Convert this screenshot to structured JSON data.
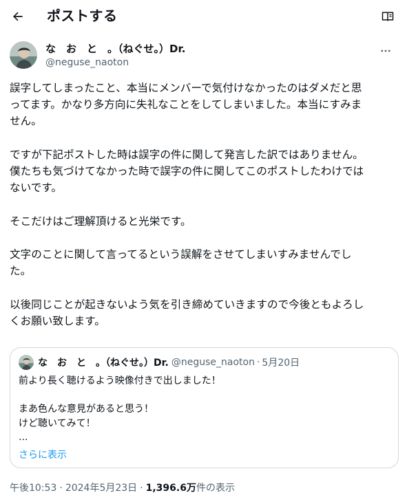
{
  "header": {
    "title": "ポストする",
    "back_icon": "arrow-left-icon",
    "reader_icon": "book-reader-icon"
  },
  "author": {
    "display_name": "な　お　と　。（ねぐせ。）Dr.",
    "handle": "@neguse_naoton",
    "more_icon": "more-horizontal-icon"
  },
  "tweet": {
    "paragraphs": [
      "誤字してしまったこと、本当にメンバーで気付けなかったのはダメだと思\nってます。かなり多方向に失礼なことをしてしまいました。本当にすみま\nせん。",
      "ですが下記ポストした時は誤字の件に関して発言した訳ではありません。\n僕たちも気づけてなかった時で誤字の件に関してこのポストしたわけでは\nないです。",
      "そこだけはご理解頂けると光栄です。",
      "文字のことに関して言ってるという誤解をさせてしまいすみませんでし\nた。",
      "以後同じことが起きないよう気を引き締めていきますので今後ともよろし\nくお願い致します。"
    ]
  },
  "quote": {
    "display_name": "な　お　と　。（ねぐせ。）Dr.",
    "handle": "@neguse_naoton",
    "separator": "·",
    "date": "5月20日",
    "text": "前より長く聴けるよう映像付きで出しました！\n\nまあ色んな意見があると思う！\nけど聴いてみて！\n...",
    "show_more": "さらに表示"
  },
  "meta": {
    "time": "午後10:53",
    "date": "2024年5月23日",
    "separator": "·",
    "views_count": "1,396.6万",
    "views_label": "件の表示"
  },
  "colors": {
    "text": "#0f1419",
    "secondary": "#536471",
    "link": "#1d9bf0",
    "border": "#cfd9de"
  }
}
